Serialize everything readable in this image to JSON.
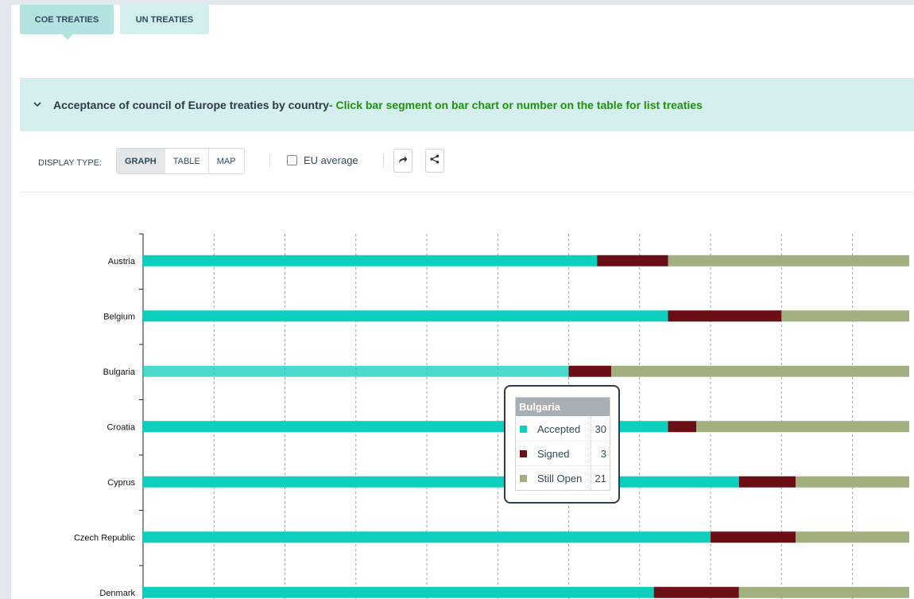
{
  "tabs": [
    {
      "label": "COE TREATIES",
      "active": true
    },
    {
      "label": "UN TREATIES",
      "active": false
    }
  ],
  "panel": {
    "title": "Acceptance of council of Europe treaties by country",
    "hint": " - Click bar segment on bar chart or number on the table for list treaties"
  },
  "toolbar": {
    "display_type_label": "DISPLAY TYPE:",
    "modes": [
      "GRAPH",
      "TABLE",
      "MAP"
    ],
    "active_mode": "GRAPH",
    "eu_average_label": "EU average",
    "eu_average_checked": false,
    "icons": [
      "share-arrow-icon",
      "share-nodes-icon"
    ]
  },
  "colors": {
    "accepted": "#0dcfbe",
    "signed": "#6b0f16",
    "still_open": "#a2b07f",
    "hint_green": "#22900f"
  },
  "chart_data": {
    "type": "bar",
    "orientation": "horizontal",
    "stacked": true,
    "categories": [
      "Austria",
      "Belgium",
      "Bulgaria",
      "Croatia",
      "Cyprus",
      "Czech Republic",
      "Denmark"
    ],
    "series": [
      {
        "name": "Accepted",
        "values": [
          32,
          37,
          30,
          37,
          42,
          40,
          36
        ]
      },
      {
        "name": "Signed",
        "values": [
          5,
          8,
          3,
          2,
          4,
          6,
          6
        ]
      },
      {
        "name": "Still Open",
        "values": [
          17,
          9,
          21,
          15,
          8,
          8,
          12
        ]
      }
    ],
    "xlim": [
      0,
      54
    ],
    "grid": true,
    "highlighted": "Bulgaria"
  },
  "tooltip": {
    "title": "Bulgaria",
    "rows": [
      {
        "label": "Accepted",
        "value": "30"
      },
      {
        "label": "Signed",
        "value": "3"
      },
      {
        "label": "Still Open",
        "value": "21"
      }
    ]
  }
}
